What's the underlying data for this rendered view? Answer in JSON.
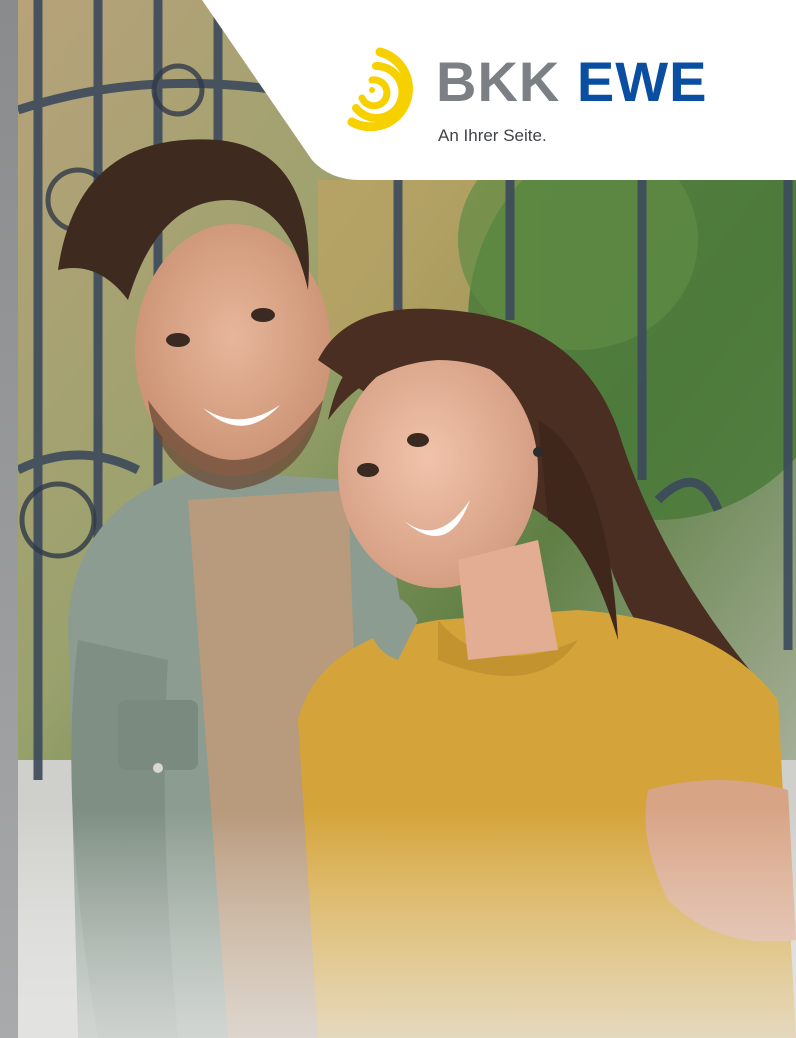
{
  "brand": {
    "name_part_a": "BKK",
    "name_part_b": "EWE",
    "tagline": "An Ihrer Seite.",
    "colors": {
      "grey": "#7c8085",
      "blue": "#0a4ea2",
      "yellow": "#f7d000"
    }
  },
  "photo": {
    "colors": {
      "sweater": "#d4a43a",
      "shirt": "#8a9a8e",
      "foliage": "#4e7a3e",
      "fence": "#3c4a5c"
    }
  }
}
